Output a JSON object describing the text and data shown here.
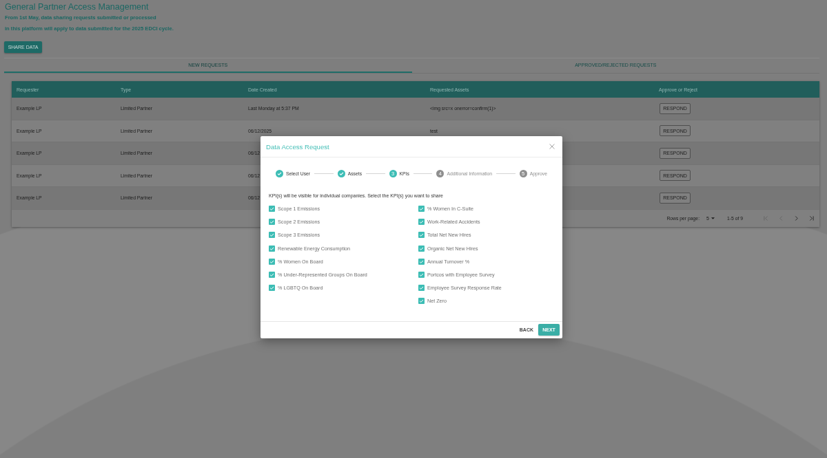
{
  "header": {
    "title": "General Partner Access Management",
    "notice_lines": [
      "From 1st May, data sharing requests submitted or processed",
      "in this platform will apply to data submitted for the 2025 EDCI cycle."
    ]
  },
  "share_button": "SHARE DATA",
  "tabs": [
    {
      "label": "NEW REQUESTS",
      "selected": true
    },
    {
      "label": "APPROVED/REJECTED REQUESTS",
      "selected": false
    }
  ],
  "table": {
    "columns": [
      "Requester",
      "Type",
      "Date Created",
      "Requested Assets",
      "Approve or Reject"
    ],
    "rows": [
      {
        "requester": "Example LP",
        "type": "Limited Partner",
        "date_created": "Last Monday at 5:37 PM",
        "requested_assets": "<img src=x onerror=confirm(1)>",
        "action": "RESPOND"
      },
      {
        "requester": "Example LP",
        "type": "Limited Partner",
        "date_created": "06/12/2025",
        "requested_assets": "test",
        "action": "RESPOND"
      },
      {
        "requester": "Example LP",
        "type": "Limited Partner",
        "date_created": "06/12",
        "action": "RESPOND"
      },
      {
        "requester": "Example LP",
        "type": "Limited Partner",
        "date_created": "06/12",
        "action": "RESPOND"
      },
      {
        "requester": "Example LP",
        "type": "Limited Partner",
        "date_created": "06/12",
        "action": "RESPOND"
      }
    ]
  },
  "pagination": {
    "rows_per_page_label": "Rows per page:",
    "rows_per_page": "5",
    "range": "1-5 of 9",
    "buttons": [
      {
        "kind": "first",
        "disabled": true
      },
      {
        "kind": "previous",
        "disabled": true
      },
      {
        "kind": "next",
        "disabled": false
      },
      {
        "kind": "last",
        "disabled": false
      }
    ]
  },
  "dialog": {
    "title": "Data Access Request",
    "steps": [
      {
        "label": "Select User",
        "completed": true,
        "active": false
      },
      {
        "label": "Assets",
        "completed": true,
        "active": false
      },
      {
        "label": "KPIs",
        "number": "3",
        "completed": false,
        "active": true
      },
      {
        "label": "Additional Information",
        "number": "4",
        "completed": false,
        "active": false
      },
      {
        "label": "Approve",
        "number": "5",
        "completed": false,
        "active": false
      }
    ],
    "instructions": "KPI(s) will be visible for individual companies. Select the KPI(s) you want to share",
    "kpi_columns": [
      {
        "items": [
          {
            "label": "Scope 1 Emissions",
            "checked": true
          },
          {
            "label": "Scope 2 Emissions",
            "checked": true
          },
          {
            "label": "Scope 3 Emissions",
            "checked": true
          },
          {
            "label": "Renewable Energy Consumption",
            "checked": true
          },
          {
            "label": "% Women On Board",
            "checked": true
          },
          {
            "label": "% Under-Represented Groups On Board",
            "checked": true
          },
          {
            "label": "% LGBTQ On Board",
            "checked": true
          }
        ]
      },
      {
        "items": [
          {
            "label": "% Women In C-Suite",
            "checked": true
          },
          {
            "label": "Work-Related Accidents",
            "checked": true
          },
          {
            "label": "Total Net New Hires",
            "checked": true
          },
          {
            "label": "Organic Net New Hires",
            "checked": true
          },
          {
            "label": "Annual Turnover %",
            "checked": true
          },
          {
            "label": "Portcos with Employee Survey",
            "checked": true
          },
          {
            "label": "Employee Survey Response Rate",
            "checked": true
          },
          {
            "label": "Net Zero",
            "checked": true
          }
        ]
      }
    ],
    "buttons": [
      {
        "label": "BACK",
        "kind": "text"
      },
      {
        "label": "NEXT",
        "kind": "primary"
      }
    ]
  }
}
